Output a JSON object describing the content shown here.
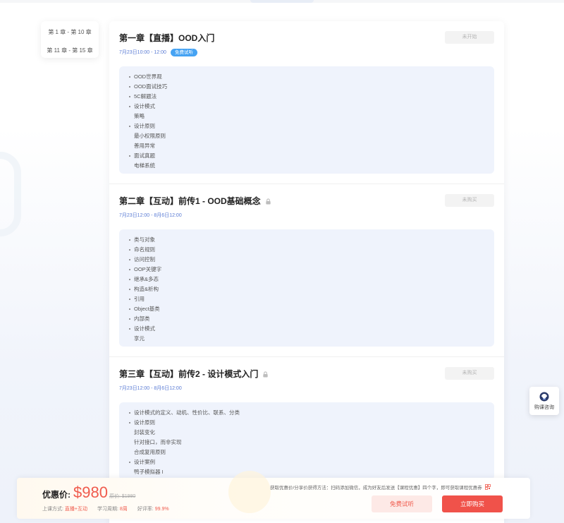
{
  "chapter_nav": {
    "items": [
      "第 1 章 - 第 10 章",
      "第 11 章 - 第 15 章"
    ]
  },
  "chapters": [
    {
      "title": "第一章【直播】OOD入门",
      "date": "7月23日10:00 - 12:00",
      "badge": "免费试听",
      "status": "未开始",
      "locked": false,
      "outline": [
        {
          "text": "OOD世界观",
          "bullet": true
        },
        {
          "text": "OOD面试技巧",
          "bullet": true
        },
        {
          "text": "5C解题法",
          "bullet": true
        },
        {
          "text": "设计模式",
          "bullet": true
        },
        {
          "text": "策略",
          "bullet": false
        },
        {
          "text": "设计原则",
          "bullet": true
        },
        {
          "text": "最小权限原则",
          "bullet": false
        },
        {
          "text": "善用异常",
          "bullet": false
        },
        {
          "text": "面试真题",
          "bullet": true
        },
        {
          "text": "电梯系统",
          "bullet": false
        }
      ]
    },
    {
      "title": "第二章【互动】前传1 - OOD基础概念",
      "date": "7月23日12:00 - 8月6日12:00",
      "badge": "",
      "status": "未购买",
      "locked": true,
      "outline": [
        {
          "text": "类与对象",
          "bullet": true
        },
        {
          "text": "命名规则",
          "bullet": true
        },
        {
          "text": "访问控制",
          "bullet": true
        },
        {
          "text": "OOP关键字",
          "bullet": true
        },
        {
          "text": "继承&多态",
          "bullet": true
        },
        {
          "text": "构造&析构",
          "bullet": true
        },
        {
          "text": "引用",
          "bullet": true
        },
        {
          "text": "Object基类",
          "bullet": true
        },
        {
          "text": "内部类",
          "bullet": true
        },
        {
          "text": "设计模式",
          "bullet": true
        },
        {
          "text": "享元",
          "bullet": false
        }
      ]
    },
    {
      "title": "第三章【互动】前传2 - 设计模式入门",
      "date": "7月23日12:00 - 8月6日12:00",
      "badge": "",
      "status": "未购买",
      "locked": true,
      "outline": [
        {
          "text": "设计模式的定义、动机、性价比、联系、分类",
          "bullet": true
        },
        {
          "text": "设计原则",
          "bullet": true
        },
        {
          "text": "封装变化",
          "bullet": false
        },
        {
          "text": "针对接口，而非实现",
          "bullet": false
        },
        {
          "text": "合成复用原则",
          "bullet": false
        },
        {
          "text": "设计案例",
          "bullet": true
        },
        {
          "text": "鸭子模拟器 I",
          "bullet": false
        }
      ]
    }
  ],
  "consult": {
    "label": "购课咨询"
  },
  "buy_bar": {
    "price_label": "优惠价:",
    "price": "$980",
    "original_price": "原价: $1980",
    "promo_tip": "获取优惠价/分享价获得方法：扫码添加微信，成为好友后发送【课程优惠】四个字，即可获取课程优惠券",
    "mode_label": "上课方式:",
    "mode_value": "直播+互动",
    "cycle_label": "学习周期:",
    "cycle_value": "8周",
    "rating_label": "好评率:",
    "rating_value": "99.9%",
    "trial_button": "免费试听",
    "buy_button": "立即购买"
  },
  "colors": {
    "accent": "#f0524a",
    "link": "#5a7bd4",
    "badge": "#46a3f3",
    "outline_bg": "#eff3fc"
  }
}
